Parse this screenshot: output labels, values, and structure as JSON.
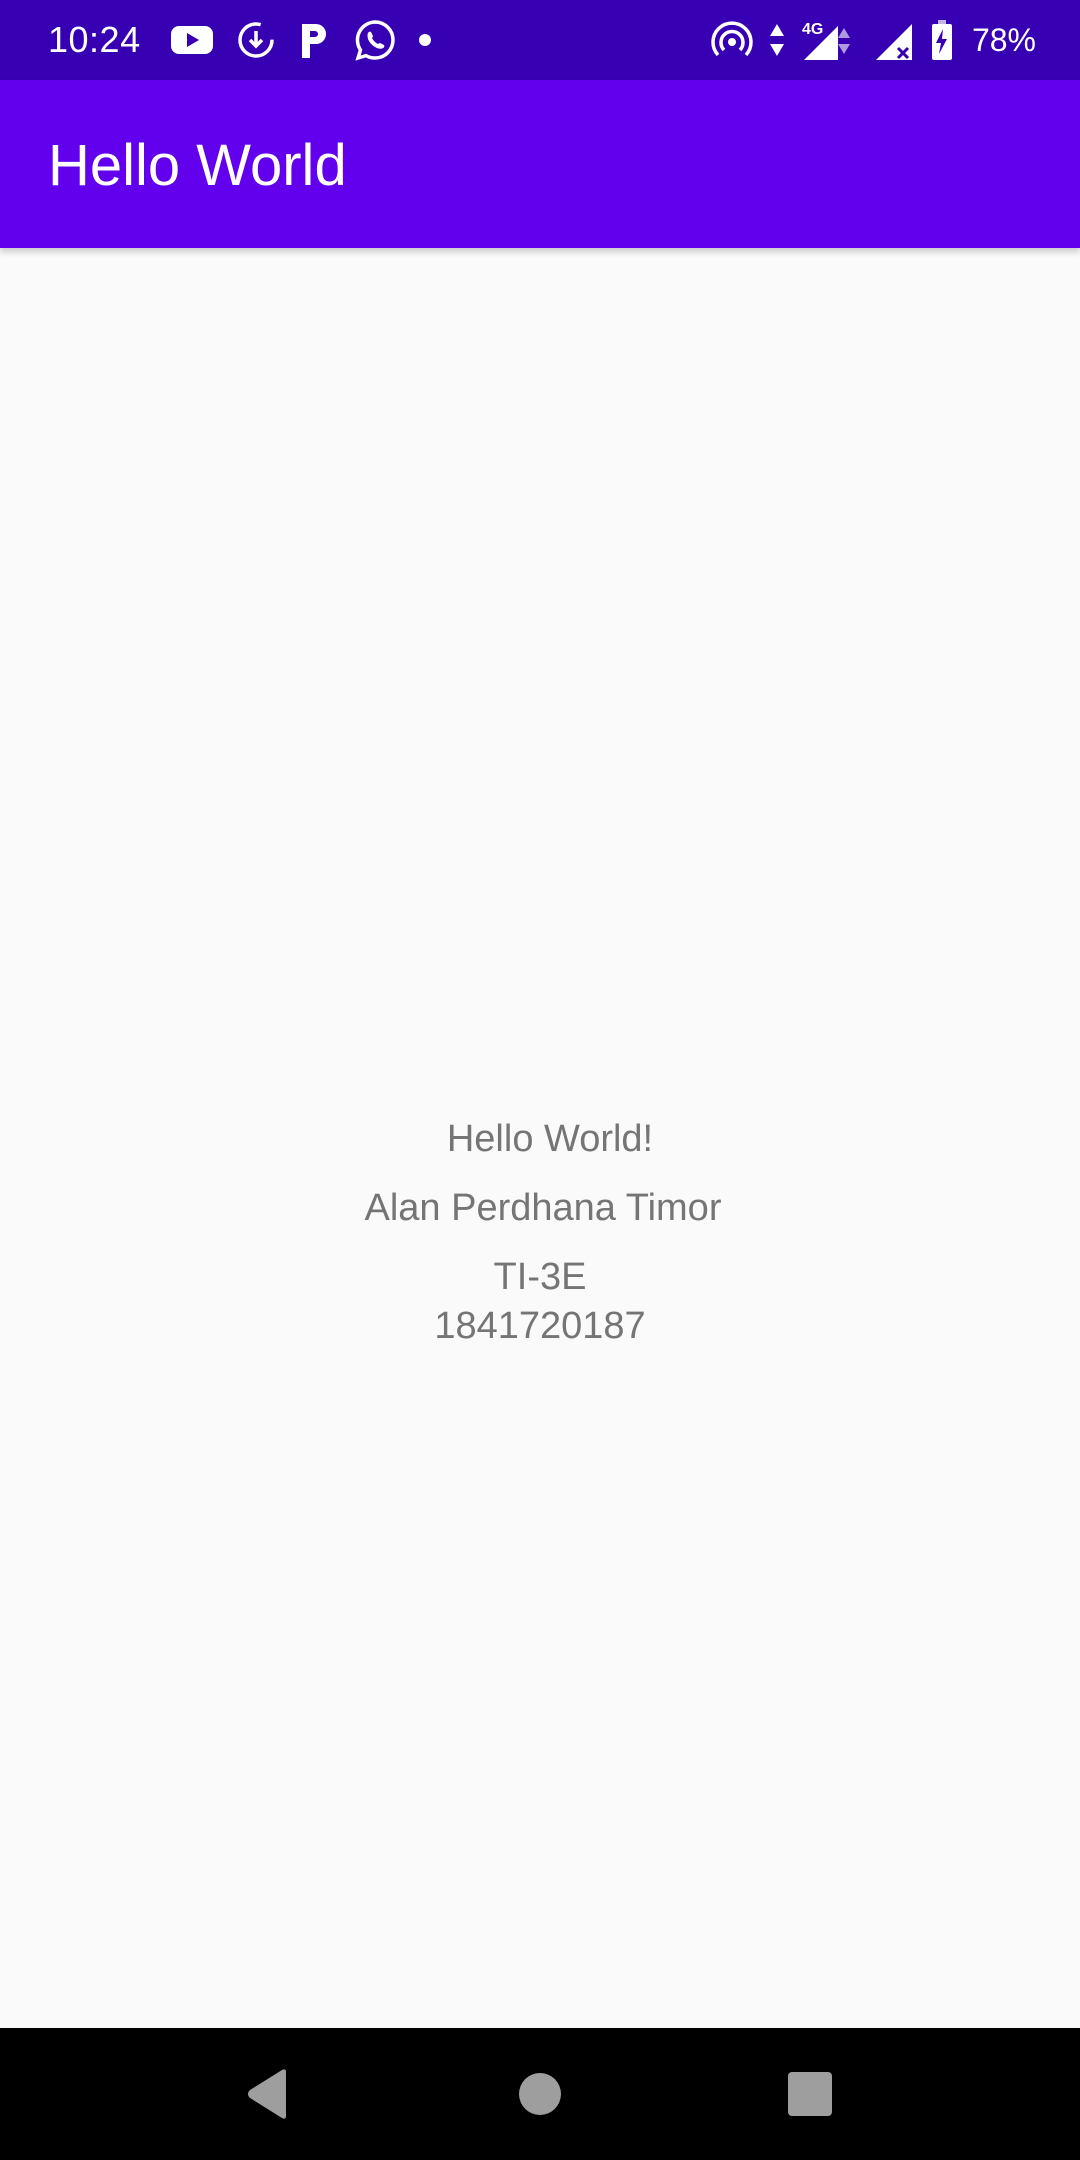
{
  "status_bar": {
    "time": "10:24",
    "battery_percent": "78%",
    "left_icons": [
      "youtube-icon",
      "update-icon",
      "p-icon",
      "whatsapp-icon",
      "dot-icon"
    ],
    "right_icons": [
      "hotspot-icon",
      "data-arrows-icon",
      "4g-signal-icon",
      "no-signal-icon",
      "battery-icon"
    ],
    "network_label": "4G"
  },
  "app_bar": {
    "title": "Hello World"
  },
  "main": {
    "greeting": "Hello World!",
    "name": "Alan Perdhana Timor",
    "class": "TI-3E",
    "student_id": "1841720187"
  },
  "colors": {
    "status_bar": "#3700b3",
    "app_bar": "#6200ee",
    "background": "#fafafa",
    "text": "#757575",
    "nav_bar": "#000000"
  },
  "nav_bar": {
    "buttons": [
      "back-icon",
      "home-icon",
      "recents-icon"
    ]
  }
}
